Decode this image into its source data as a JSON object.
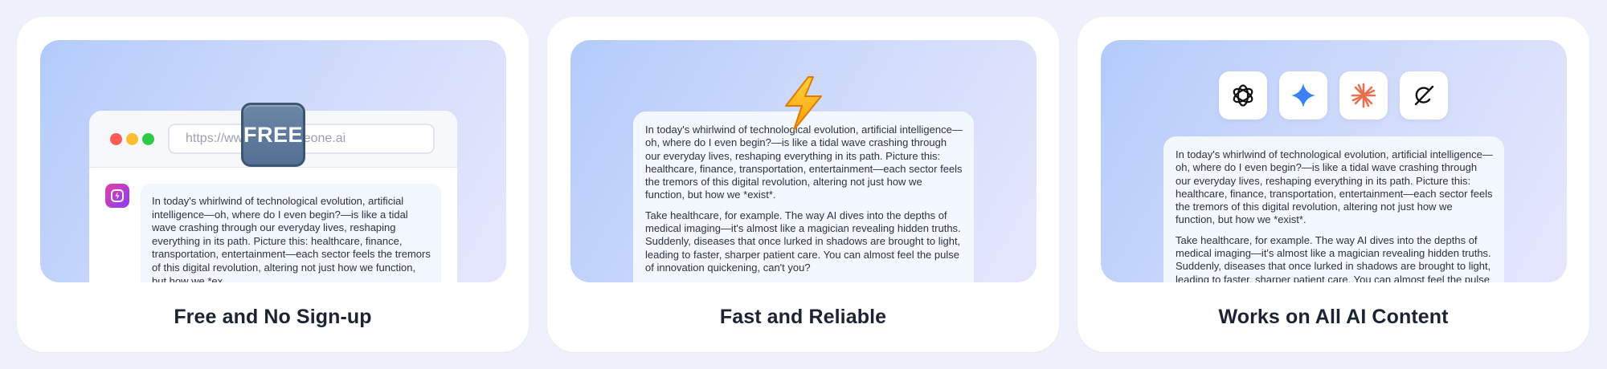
{
  "cards": [
    {
      "title": "Free and No Sign-up",
      "badge": "FREE",
      "browser": {
        "url": "https://www.humanizeone.ai",
        "message": "In today's whirlwind of technological evolution, artificial intelligence—oh, where do I even begin?—is like a tidal wave crashing through our everyday lives, reshaping everything in its path. Picture this: healthcare, finance, transportation, entertainment—each sector feels the tremors of this digital revolution, altering not just how we function, but how we *ex"
      }
    },
    {
      "title": "Fast and Reliable",
      "paragraphs": [
        "In today's whirlwind of technological evolution, artificial intelligence—oh, where do I even begin?—is like a tidal wave crashing through our everyday lives, reshaping everything in its path. Picture this: healthcare, finance, transportation, entertainment—each sector feels the tremors of this digital revolution, altering not just how we function, but how we *exist*.",
        "Take healthcare, for example. The way AI dives into the depths of medical imaging—it's almost like a magician revealing hidden truths. Suddenly, diseases that once lurked in shadows are brought to light, leading to faster, sharper patient care. You can almost feel the pulse of innovation quickening, can't you?"
      ]
    },
    {
      "title": "Works on All AI Content",
      "icons": [
        "chatgpt-icon",
        "gemini-icon",
        "claude-icon",
        "grok-icon"
      ],
      "paragraphs": [
        "In today's whirlwind of technological evolution, artificial intelligence—oh, where do I even begin?—is like a tidal wave crashing through our everyday lives, reshaping everything in its path. Picture this: healthcare, finance, transportation, entertainment—each sector feels the tremors of this digital revolution, altering not just how we function, but how we *exist*.",
        "Take healthcare, for example. The way AI dives into the depths of medical imaging—it's almost like a magician revealing hidden truths. Suddenly, diseases that once lurked in shadows are brought to light, leading to faster, sharper patient care. You can almost feel the pulse of innovation quickening, can't you?"
      ]
    }
  ],
  "colors": {
    "page_bg": "#eef1fb",
    "card_bg": "#ffffff",
    "hero_gradient_start": "#b3cbfb",
    "hero_gradient_end": "#e6e7fd",
    "title_text": "#1c2333",
    "gemini_blue": "#3b82f6",
    "claude_orange": "#e8704f"
  }
}
